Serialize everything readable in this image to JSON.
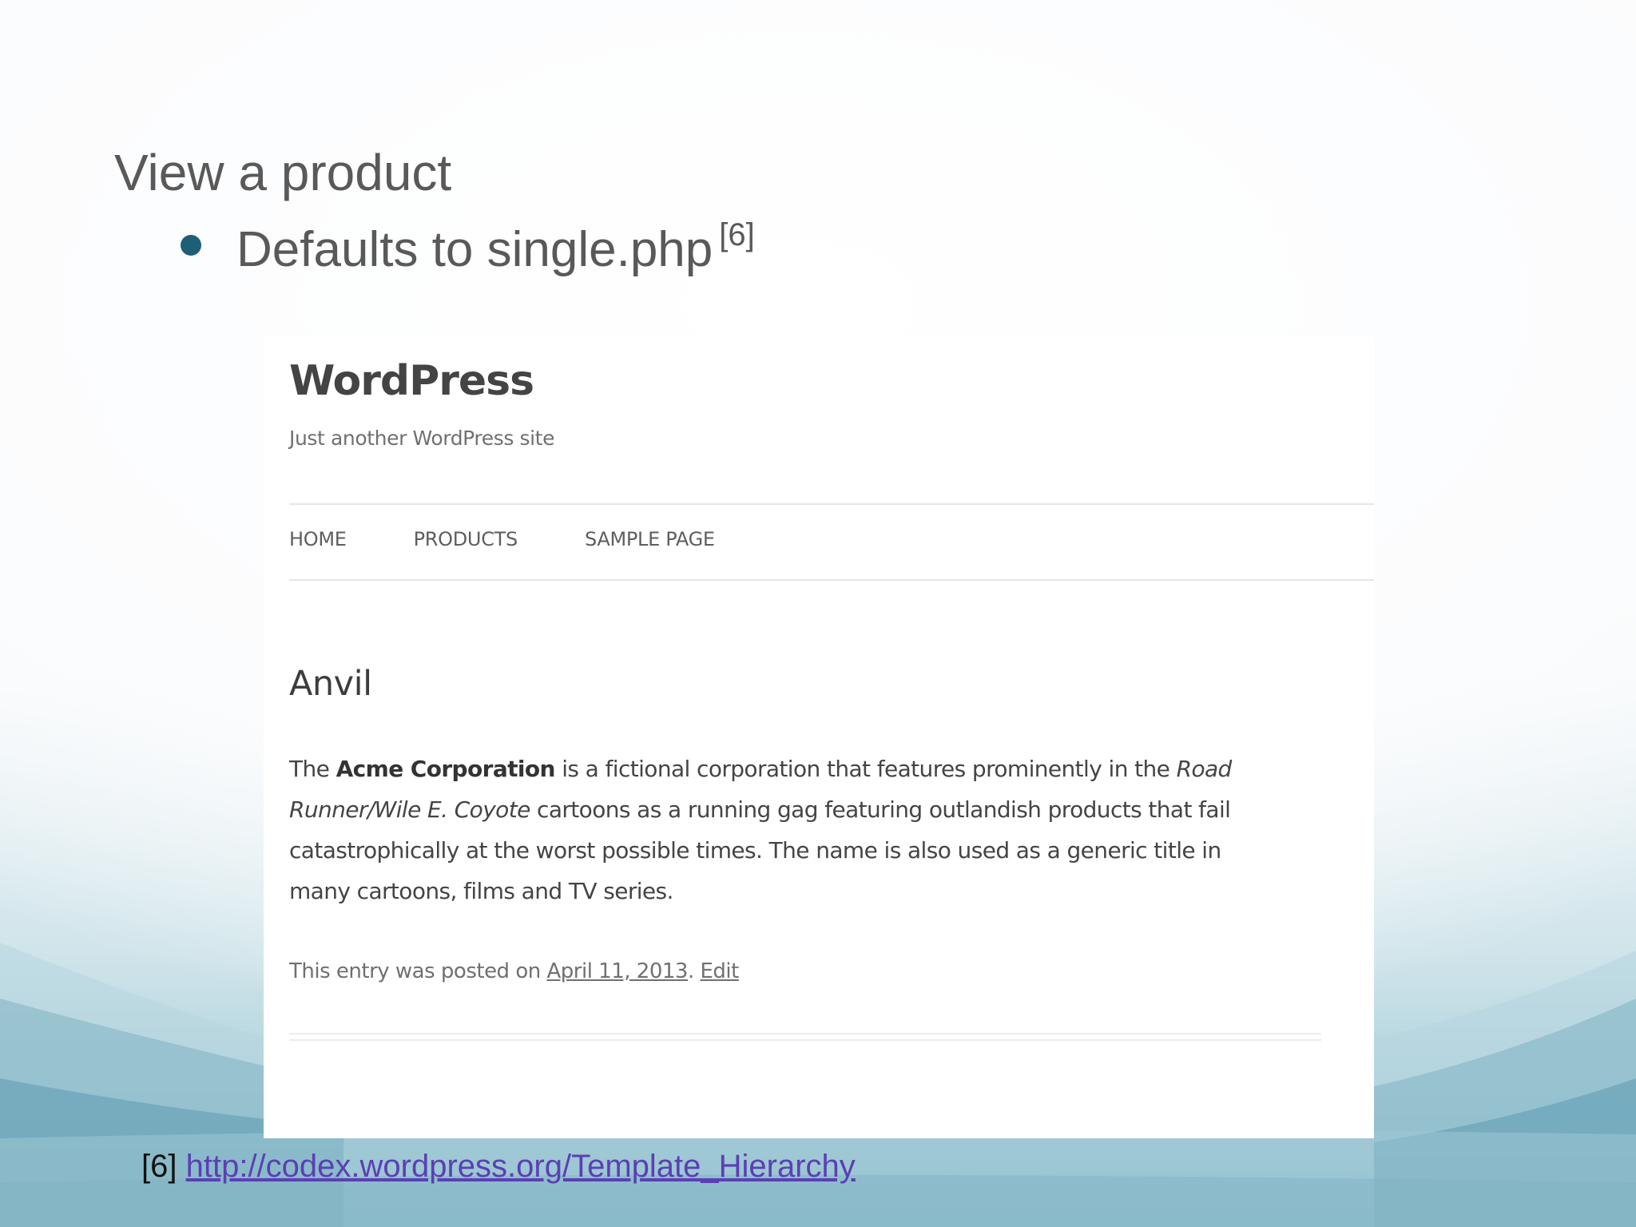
{
  "slide": {
    "title": "View a product",
    "bullet_text": "Defaults to single.php",
    "bullet_ref": "[6]",
    "bullet_color": "#1e5f78"
  },
  "wordpress": {
    "site_title": "WordPress",
    "tagline": "Just another WordPress site",
    "nav": [
      {
        "label": "HOME"
      },
      {
        "label": "PRODUCTS"
      },
      {
        "label": "SAMPLE PAGE"
      }
    ],
    "entry_title": "Anvil",
    "content": {
      "part1": "The ",
      "bold": "Acme Corporation",
      "part2": " is a fictional corporation that features prominently in the ",
      "italic": "Road Runner/Wile E. Coyote",
      "part3": " cartoons as a running gag featuring outlandish products that fail catastrophically at the worst possible times. The name is also used as a generic title in many cartoons, films and TV series."
    },
    "meta": {
      "prefix": "This entry was posted on ",
      "date": "April 11, 2013",
      "separator": ". ",
      "edit": "Edit"
    }
  },
  "footnote": {
    "ref": "[6]",
    "link": "http://codex.wordpress.org/Template_Hierarchy",
    "link_color": "#5b3fb5"
  }
}
